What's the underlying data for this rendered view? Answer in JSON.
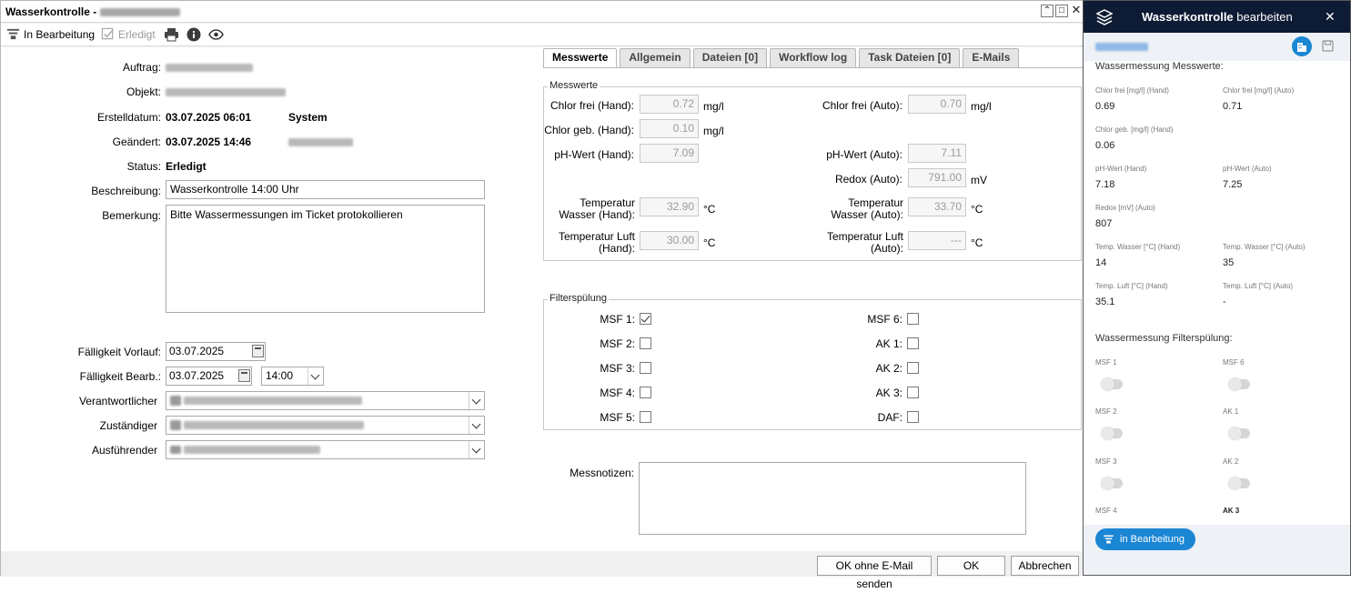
{
  "window": {
    "title": "Wasserkontrolle -"
  },
  "toolbar": {
    "in_bearbeitung": "In Bearbeitung",
    "erledigt": "Erledigt"
  },
  "form": {
    "auftrag_label": "Auftrag:",
    "objekt_label": "Objekt:",
    "erstelldatum_label": "Erstelldatum:",
    "erstelldatum_value": "03.07.2025 06:01",
    "erstellt_von": "System",
    "geaendert_label": "Geändert:",
    "geaendert_value": "03.07.2025 14:46",
    "status_label": "Status:",
    "status_value": "Erledigt",
    "beschreibung_label": "Beschreibung:",
    "beschreibung_value": "Wasserkontrolle 14:00 Uhr",
    "bemerkung_label": "Bemerkung:",
    "bemerkung_value": "Bitte Wassermessungen im Ticket protokollieren",
    "faelligkeit_vorlauf_label": "Fälligkeit Vorlauf:",
    "faelligkeit_vorlauf_value": "03.07.2025",
    "faelligkeit_bearb_label": "Fälligkeit Bearb.:",
    "faelligkeit_bearb_date": "03.07.2025",
    "faelligkeit_bearb_time": "14:00",
    "verantwortlicher_label": "Verantwortlicher",
    "zustaendiger_label": "Zuständiger",
    "ausfuehrender_label": "Ausführender"
  },
  "tabs": [
    "Messwerte",
    "Allgemein",
    "Dateien  [0]",
    "Workflow log",
    "Task Dateien  [0]",
    "E-Mails"
  ],
  "messwerte": {
    "legend": "Messwerte",
    "chlor_frei_hand_label": "Chlor frei (Hand):",
    "chlor_frei_hand": "0.72",
    "chlor_frei_hand_unit": "mg/l",
    "chlor_frei_auto_label": "Chlor frei (Auto):",
    "chlor_frei_auto": "0.70",
    "chlor_frei_auto_unit": "mg/l",
    "chlor_geb_hand_label": "Chlor geb. (Hand):",
    "chlor_geb_hand": "0.10",
    "chlor_geb_hand_unit": "mg/l",
    "ph_hand_label": "pH-Wert (Hand):",
    "ph_hand": "7.09",
    "ph_auto_label": "pH-Wert (Auto):",
    "ph_auto": "7.11",
    "redox_auto_label": "Redox (Auto):",
    "redox_auto": "791.00",
    "redox_auto_unit": "mV",
    "temp_wasser_hand_label_1": "Temperatur",
    "temp_wasser_hand_label_2": "Wasser (Hand):",
    "temp_wasser_hand": "32.90",
    "temp_wasser_hand_unit": "°C",
    "temp_wasser_auto_label_1": "Temperatur",
    "temp_wasser_auto_label_2": "Wasser (Auto):",
    "temp_wasser_auto": "33.70",
    "temp_wasser_auto_unit": "°C",
    "temp_luft_hand_label_1": "Temperatur Luft",
    "temp_luft_hand_label_2": "(Hand):",
    "temp_luft_hand": "30.00",
    "temp_luft_hand_unit": "°C",
    "temp_luft_auto_label_1": "Temperatur Luft",
    "temp_luft_auto_label_2": "(Auto):",
    "temp_luft_auto": "---",
    "temp_luft_auto_unit": "°C"
  },
  "filter": {
    "legend": "Filterspülung",
    "left": [
      {
        "label": "MSF 1:",
        "checked": true
      },
      {
        "label": "MSF 2:",
        "checked": false
      },
      {
        "label": "MSF 3:",
        "checked": false
      },
      {
        "label": "MSF 4:",
        "checked": false
      },
      {
        "label": "MSF 5:",
        "checked": false
      }
    ],
    "right": [
      {
        "label": "MSF 6:",
        "checked": false
      },
      {
        "label": "AK 1:",
        "checked": false
      },
      {
        "label": "AK 2:",
        "checked": false
      },
      {
        "label": "AK 3:",
        "checked": false
      },
      {
        "label": "DAF:",
        "checked": false
      }
    ]
  },
  "messnotizen_label": "Messnotizen:",
  "footer": {
    "ok_ohne_mail": "OK ohne E-Mail senden",
    "ok": "OK",
    "abbrechen": "Abbrechen"
  },
  "panel": {
    "title_main": "Wasserkontrolle",
    "title_rest": " bearbeiten",
    "section_messwerte": "Wassermessung Messwerte:",
    "fields": [
      {
        "label": "Chlor frei [mg/l] (Hand)",
        "value": "0.69"
      },
      {
        "label": "Chlor frei [mg/l] (Auto)",
        "value": "0.71"
      },
      {
        "label": "Chlor geb. [mg/l] (Hand)",
        "value": "0.06"
      },
      {
        "label": "pH-Wert (Hand)",
        "value": "7.18"
      },
      {
        "label": "pH-Wert (Auto)",
        "value": "7.25"
      },
      {
        "label": "Redox [mV] (Auto)",
        "value": "807"
      },
      {
        "label": "Temp. Wasser [°C] (Hand)",
        "value": "14"
      },
      {
        "label": "Temp. Wasser [°C] (Auto)",
        "value": "35"
      },
      {
        "label": "Temp. Luft [°C] (Hand)",
        "value": "35.1"
      },
      {
        "label": "Temp. Luft [°C] (Auto)",
        "value": "-"
      }
    ],
    "section_filter": "Wassermessung Filterspülung:",
    "toggles": [
      "MSF 1",
      "MSF 6",
      "MSF 2",
      "AK 1",
      "MSF 3",
      "AK 2",
      "MSF 4",
      "AK 3"
    ],
    "status_button": "in Bearbeitung",
    "accent": "#1b86d4",
    "header_bg": "#0e1b34"
  }
}
